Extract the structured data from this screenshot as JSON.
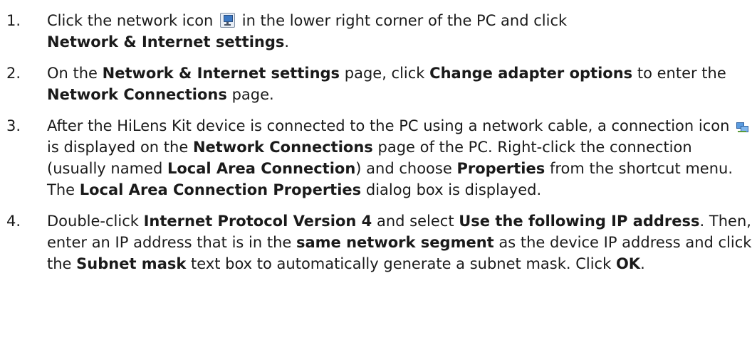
{
  "steps": [
    {
      "num": "1.",
      "pre": "Click the network icon",
      "icon": "network-tray-icon",
      "post": "in the lower right corner of the PC and click",
      "b1": "Network & Internet settings",
      "end": "."
    },
    {
      "num": "2.",
      "t1": "On the",
      "b1": "Network & Internet settings",
      "t2": "page, click",
      "b2": "Change adapter options",
      "t3": "to enter the",
      "b3": "Network Connections",
      "t4": "page."
    },
    {
      "num": "3.",
      "t1": "After the HiLens Kit device is connected to the PC using a network cable, a connection icon",
      "icon": "network-connection-icon",
      "t2": "is displayed on the",
      "b1": "Network Connections",
      "t3": "page of the PC. Right-click the connection (usually named",
      "b2": "Local Area Connection",
      "t4": ") and choose",
      "b3": "Properties",
      "t5": "from the shortcut menu. The",
      "b4": "Local Area Connection Properties",
      "t6": "dialog box is displayed."
    },
    {
      "num": "4.",
      "t1": "Double-click",
      "b1": "Internet Protocol Version 4",
      "t2": "and select",
      "b2": "Use the following IP address",
      "t3": ". Then, enter an IP address that is in the",
      "b3": "same network segment",
      "t4": "as the device IP address and click the",
      "b4": "Subnet mask",
      "t5": "text box to automatically generate a subnet mask. Click",
      "b5": "OK",
      "t6": "."
    }
  ]
}
